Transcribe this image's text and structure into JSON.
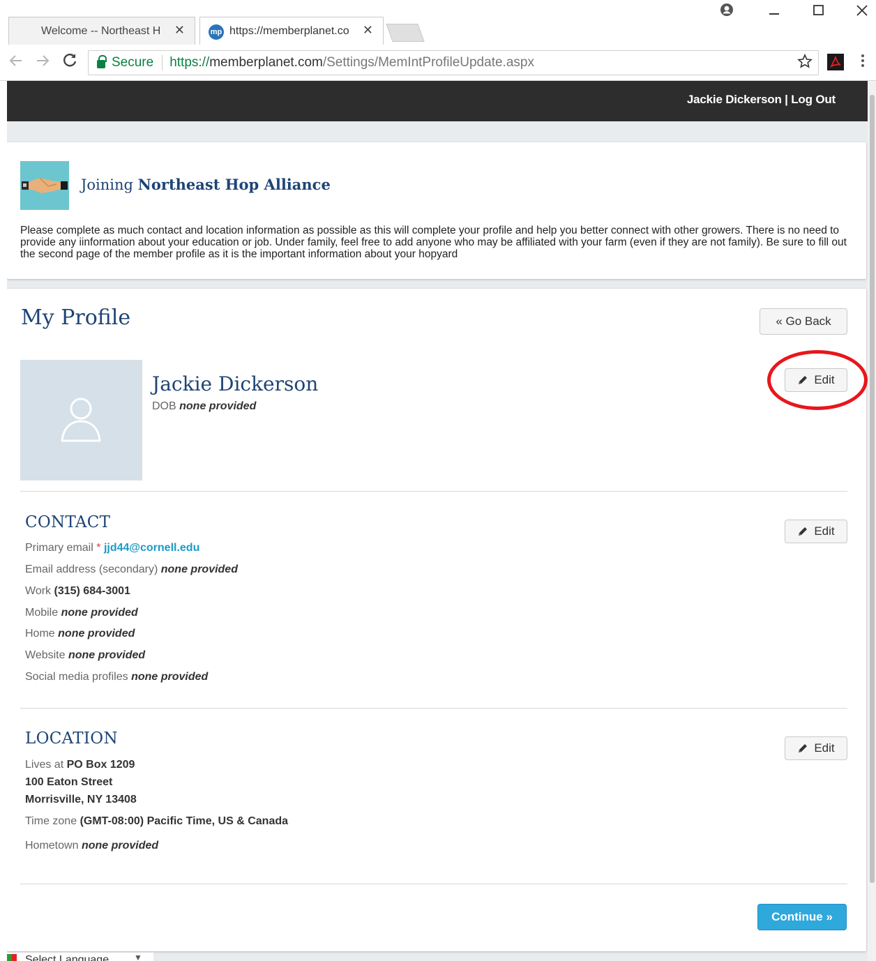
{
  "browser": {
    "tabs": [
      {
        "title": "Welcome -- Northeast H",
        "close": "✕"
      },
      {
        "title": "https://memberplanet.co",
        "close": "✕",
        "favicon": "mp"
      }
    ],
    "omnibox": {
      "secure_label": "Secure",
      "url_scheme": "https://",
      "url_host": "memberplanet.com",
      "url_path": "/Settings/MemIntProfileUpdate.aspx"
    }
  },
  "topbar": {
    "user_name": "Jackie Dickerson",
    "separator": " | ",
    "logout_label": "Log Out"
  },
  "join": {
    "prefix": "Joining ",
    "org_name": "Northeast Hop Alliance",
    "description": "Please complete as much contact and location information as possible as this will complete your profile and help you better connect with other growers. There is no need to provide any iinformation about your education or job. Under family, feel free to add anyone who may be affiliated with your farm (even if they are not family). Be sure to fill out the second page of the member profile as it is the important information about your hopyard"
  },
  "profile": {
    "page_title": "My Profile",
    "go_back_label": "« Go Back",
    "edit_label": "Edit",
    "name": "Jackie Dickerson",
    "dob_label": "DOB",
    "dob_value": "none provided"
  },
  "contact": {
    "title": "CONTACT",
    "primary_email_label": "Primary email",
    "required_mark": "*",
    "primary_email_value": "jjd44@cornell.edu",
    "secondary_email_label": "Email address (secondary)",
    "secondary_email_value": "none provided",
    "work_label": "Work",
    "work_value": "(315) 684-3001",
    "mobile_label": "Mobile",
    "mobile_value": "none provided",
    "home_label": "Home",
    "home_value": "none provided",
    "website_label": "Website",
    "website_value": "none provided",
    "social_label": "Social media profiles",
    "social_value": "none provided"
  },
  "location": {
    "title": "LOCATION",
    "lives_at_label": "Lives at",
    "address_line1": "PO Box 1209",
    "address_line2": "100 Eaton Street",
    "address_line3": "Morrisville, NY 13408",
    "timezone_label": "Time zone",
    "timezone_value": "(GMT-08:00) Pacific Time, US & Canada",
    "hometown_label": "Hometown",
    "hometown_value": "none provided"
  },
  "footer": {
    "continue_label": "Continue »",
    "language_label": "Select Language"
  },
  "colors": {
    "brand_navy": "#1e4475",
    "link_blue": "#1b9bc8",
    "continue_blue": "#2fa8dc",
    "topbar_dark": "#2d2d2d",
    "annotation_red": "#e8161b",
    "handshake_teal": "#6cc6d0"
  },
  "icons": [
    "account-icon",
    "minimize-icon",
    "maximize-icon",
    "close-window-icon",
    "back-arrow-icon",
    "forward-arrow-icon",
    "reload-icon",
    "lock-icon",
    "star-icon",
    "pdf-icon",
    "menu-icon",
    "handshake-icon",
    "user-placeholder-icon",
    "pencil-icon",
    "flag-icon",
    "dropdown-arrow-icon"
  ]
}
